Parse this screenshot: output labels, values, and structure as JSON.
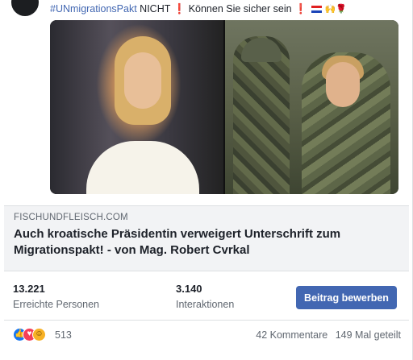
{
  "post": {
    "hashtag": "#UNmigrationsPakt",
    "text_before": "NICHT",
    "exclaim": "❗",
    "text_after": "Können Sie sicher sein",
    "exclaim2": "❗",
    "emoji_tail": "🙌🌹"
  },
  "link_preview": {
    "domain": "FISCHUNDFLEISCH.COM",
    "title": "Auch kroatische Präsidentin verweigert Unterschrift zum Migrationspakt! - von Mag. Robert Cvrkal"
  },
  "insights": {
    "reached_value": "13.221",
    "reached_label": "Erreichte Personen",
    "interactions_value": "3.140",
    "interactions_label": "Interaktionen",
    "promote_label": "Beitrag bewerben"
  },
  "footer": {
    "reaction_icons": [
      "like-icon",
      "love-icon",
      "haha-icon"
    ],
    "reaction_count": "513",
    "comments": "42 Kommentare",
    "shares": "149 Mal geteilt"
  },
  "colors": {
    "accent": "#4267b2",
    "link_bg": "#f2f3f5",
    "muted_text": "#606770"
  }
}
